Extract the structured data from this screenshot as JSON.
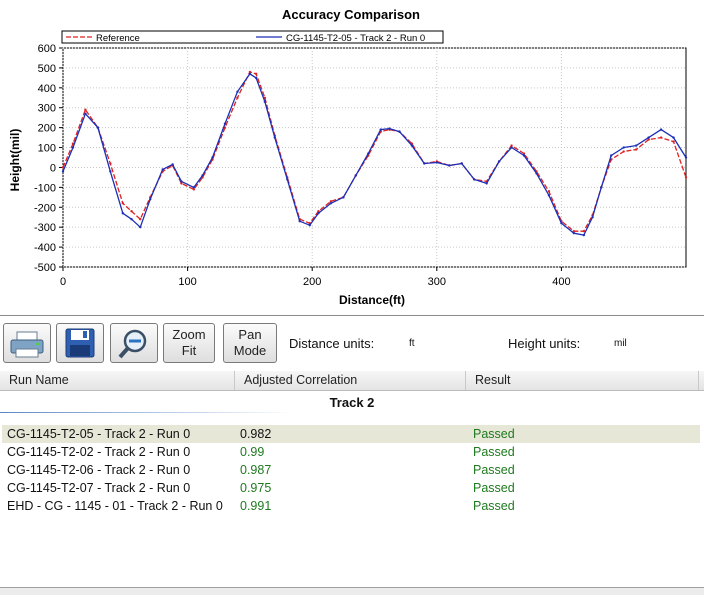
{
  "chart_data": {
    "type": "line",
    "title": "Accuracy Comparison",
    "xlabel": "Distance(ft)",
    "ylabel": "Height(mil)",
    "xlim": [
      0,
      500
    ],
    "ylim": [
      -500,
      600
    ],
    "xticks": [
      0,
      100,
      200,
      300,
      400
    ],
    "yticks": [
      -500,
      -400,
      -300,
      -200,
      -100,
      0,
      100,
      200,
      300,
      400,
      500,
      600
    ],
    "grid": true,
    "legend": "top",
    "series": [
      {
        "name": "Reference",
        "color": "#dd2222",
        "style": "dashed",
        "x": [
          0,
          8,
          18,
          28,
          38,
          48,
          55,
          62,
          70,
          80,
          88,
          95,
          105,
          112,
          120,
          130,
          140,
          150,
          155,
          162,
          170,
          180,
          190,
          198,
          205,
          215,
          225,
          235,
          245,
          255,
          262,
          270,
          280,
          290,
          300,
          310,
          320,
          330,
          340,
          350,
          360,
          370,
          380,
          390,
          400,
          410,
          418,
          425,
          432,
          440,
          450,
          460,
          470,
          480,
          490,
          500
        ],
        "y": [
          0,
          120,
          290,
          200,
          20,
          -180,
          -220,
          -260,
          -150,
          -20,
          10,
          -80,
          -110,
          -50,
          40,
          200,
          350,
          480,
          470,
          350,
          160,
          -50,
          -260,
          -280,
          -220,
          -170,
          -150,
          -40,
          60,
          180,
          190,
          180,
          120,
          20,
          30,
          10,
          20,
          -60,
          -70,
          30,
          110,
          70,
          -20,
          -120,
          -270,
          -320,
          -320,
          -240,
          -100,
          40,
          80,
          90,
          140,
          150,
          130,
          -50
        ]
      },
      {
        "name": "CG-1145-T2-05 - Track 2 - Run 0",
        "color": "#1b2fb8",
        "style": "solid",
        "x": [
          0,
          8,
          18,
          28,
          38,
          48,
          55,
          62,
          70,
          80,
          88,
          95,
          105,
          112,
          120,
          130,
          140,
          150,
          155,
          162,
          170,
          180,
          190,
          198,
          205,
          215,
          225,
          235,
          245,
          255,
          262,
          270,
          280,
          290,
          300,
          310,
          320,
          330,
          340,
          350,
          360,
          370,
          380,
          390,
          400,
          410,
          418,
          425,
          432,
          440,
          450,
          460,
          470,
          480,
          490,
          500
        ],
        "y": [
          -20,
          100,
          270,
          200,
          -20,
          -230,
          -260,
          -300,
          -160,
          -10,
          15,
          -70,
          -100,
          -40,
          50,
          220,
          380,
          470,
          450,
          330,
          150,
          -60,
          -270,
          -290,
          -230,
          -180,
          -150,
          -40,
          70,
          190,
          195,
          180,
          110,
          20,
          25,
          10,
          20,
          -60,
          -80,
          30,
          100,
          60,
          -30,
          -140,
          -280,
          -330,
          -340,
          -250,
          -100,
          60,
          100,
          110,
          150,
          190,
          150,
          50
        ]
      }
    ]
  },
  "toolbar": {
    "print_icon": "printer-icon",
    "save_icon": "floppy-disk-icon",
    "zoom_icon": "magnifier-icon",
    "zoom_fit_line1": "Zoom",
    "zoom_fit_line2": "Fit",
    "pan_mode_line1": "Pan",
    "pan_mode_line2": "Mode",
    "distance_units_label": "Distance units:",
    "distance_units_value": "ft",
    "height_units_label": "Height units:",
    "height_units_value": "mil"
  },
  "grid": {
    "columns": [
      "Run Name",
      "Adjusted Correlation",
      "Result"
    ],
    "group_title": "Track 2",
    "rows": [
      {
        "name": "CG-1145-T2-05 - Track 2 - Run 0",
        "correlation": "0.982",
        "result": "Passed",
        "selected": true
      },
      {
        "name": "CG-1145-T2-02 - Track 2 - Run 0",
        "correlation": "0.99",
        "result": "Passed",
        "selected": false
      },
      {
        "name": "CG-1145-T2-06 - Track 2 - Run 0",
        "correlation": "0.987",
        "result": "Passed",
        "selected": false
      },
      {
        "name": "CG-1145-T2-07 - Track 2 - Run 0",
        "correlation": "0.975",
        "result": "Passed",
        "selected": false
      },
      {
        "name": "EHD - CG - 1145 - 01 - Track 2 - Run 0",
        "correlation": "0.991",
        "result": "Passed",
        "selected": false
      }
    ]
  }
}
